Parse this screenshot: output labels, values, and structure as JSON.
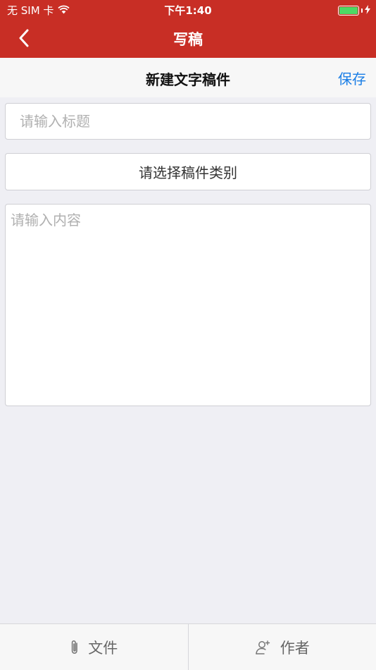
{
  "status_bar": {
    "carrier": "无 SIM 卡",
    "time": "下午1:40"
  },
  "nav": {
    "title": "写稿",
    "back_icon": "chevron-left-icon"
  },
  "editor": {
    "header_title": "新建文字稿件",
    "save_label": "保存",
    "title_placeholder": "请输入标题",
    "category_label": "请选择稿件类别",
    "content_placeholder": "请输入内容"
  },
  "tabbar": {
    "tabs": [
      {
        "label": "文件",
        "icon": "paperclip-icon"
      },
      {
        "label": "作者",
        "icon": "person-add-icon"
      }
    ]
  },
  "colors": {
    "header_red": "#c82e25",
    "link_blue": "#1a7ee6",
    "battery_green": "#4cd964"
  }
}
